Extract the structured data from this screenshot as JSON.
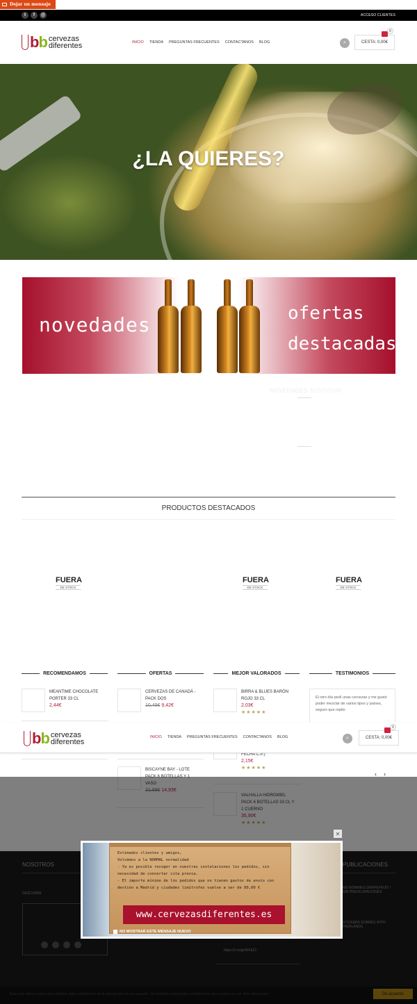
{
  "message_tab": {
    "label": "Dejar un mensaje"
  },
  "topbar": {
    "social": [
      {
        "icon": "twitter-icon",
        "glyph": "t"
      },
      {
        "icon": "facebook-icon",
        "glyph": "f"
      },
      {
        "icon": "email-icon",
        "glyph": "@"
      }
    ],
    "account_label": "ACCESO CLIENTES"
  },
  "logo": {
    "b1": "b",
    "b2": "b",
    "line1": "cervezas",
    "line2": "diferentes"
  },
  "nav": [
    "INICIO",
    "TIENDA",
    "PREGUNTAS FRECUENTES",
    "CONTACTANOS",
    "BLOG"
  ],
  "cart": {
    "label": "CESTA: 0,00€",
    "count": "0"
  },
  "hero": {
    "title": "¿LA QUIERES?"
  },
  "banner": {
    "left": "novedades",
    "right_line1": "ofertas",
    "right_line2": "destacadas"
  },
  "faint_text": "NOVEDADES SUSTITUIR",
  "featured": {
    "title": "PRODUCTOS DESTACADOS",
    "out_of_stock": {
      "big": "FUERA",
      "small": "DE STOCK"
    }
  },
  "columns": {
    "recomendamos": {
      "title": "RECOMENDAMOS",
      "items": [
        {
          "name": "MEANTIME CHOCOLATE PORTER 33 CL",
          "price": "2,44€"
        }
      ]
    },
    "ofertas": {
      "title": "OFERTAS",
      "items": [
        {
          "name": "CERVEZAS DE CANADÁ - PACK DOS",
          "old_price": "10,45€",
          "price": "9,42€"
        },
        {
          "name": "BISCAYNE BAY - LOTE PACK 6 BOTELLAS Y 1 VASO",
          "old_price": "21,86€",
          "price": "14,93€"
        }
      ]
    },
    "mejor_valorados": {
      "title": "MEJOR VALORADOS",
      "items": [
        {
          "name": "BIRRA & BLUES BARÓN ROJO 33 CL",
          "price": "2,03€",
          "stars": "★★★★★"
        },
        {
          "name": "FECHA C.P.)",
          "price": "2,15€",
          "stars": "★★★★★"
        },
        {
          "name": "VALHALLA HIDROMIEL PACK 6 BOTELLAS 33 CL Y 1 CUERNO",
          "price": "35,90€",
          "stars": "★★★★★"
        }
      ]
    },
    "testimonios": {
      "title": "TESTIMONIOS",
      "text": "El otro día pedí unas cervezas y me gustó poder mezclar de varios tipos y países, seguro que repito"
    }
  },
  "carousel": {
    "prev": "‹",
    "next": "›"
  },
  "footer": {
    "nosotros": "NOSOTROS",
    "descubre": "DESCUBRE",
    "publicaciones": "PUBLICACIONES",
    "pub1": "NO WORRIES GRAPEFRUIT / SIN PREOCUPACIONES",
    "pub2": "STICKERS DOBRES WITH HIGHLANDS",
    "tweet": "https://t.co/gn9hFbZ2"
  },
  "popup": {
    "close": "✕",
    "lines": [
      "Estimados clientes y amigos,",
      "Volvemos a la NORMAL normalidad",
      "- Ya es posible recoger en nuestras instalaciones los pedidos, sin necesidad de concertar cita previa.",
      "- El importe mínimo de los pedidos que no tienen gastos de envío con destino a Madrid y ciudades limítrofes vuelve a ser de 89,00 €"
    ],
    "url": "www.cervezasdiferentes.es",
    "dismiss": "NO MOSTRAR ESTE MENSAJE NUEVO"
  },
  "cookie": {
    "text": "Esta web utiliza cookies para obtener datos estadísticos de la navegación de sus usuarios. Si continúas navegando consideramos que aceptas su uso. Más información",
    "button": "De acuerdo"
  }
}
